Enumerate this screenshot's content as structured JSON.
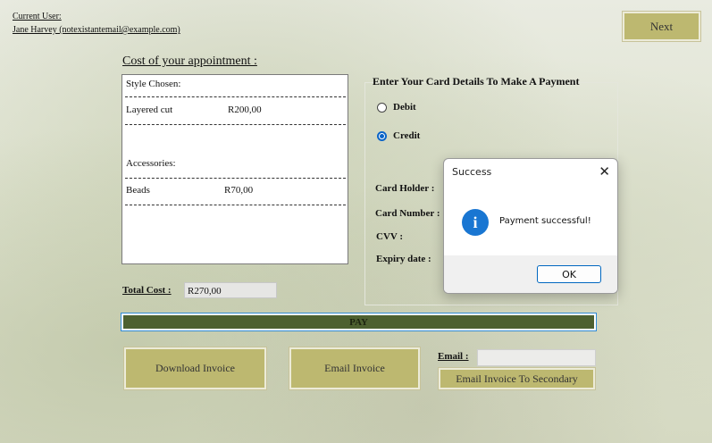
{
  "user": {
    "label": "Current User:",
    "name_email": "Jane Harvey (notexistantemail@example.com)"
  },
  "next_label": "Next",
  "cost": {
    "title": "Cost of your appointment :",
    "style_header": "Style Chosen:",
    "style_item": "Layered cut",
    "style_price": "R200,00",
    "accessories_header": "Accessories:",
    "accessory_item": "Beads",
    "accessory_price": "R70,00"
  },
  "card": {
    "title": "Enter Your Card Details To Make A Payment",
    "debit": "Debit",
    "credit": "Credit",
    "selected": "Credit",
    "holder": "Card Holder :",
    "number": "Card Number :",
    "cvv": "CVV :",
    "expiry": "Expiry date :"
  },
  "total": {
    "label": "Total Cost :",
    "value": "R270,00"
  },
  "pay_label": "PAY",
  "download_label": "Download Invoice",
  "email_invoice_label": "Email Invoice",
  "email": {
    "label": "Email :",
    "value": ""
  },
  "secondary_label": "Email Invoice To Secondary",
  "dialog": {
    "title": "Success",
    "message": "Payment successful!",
    "ok": "OK"
  },
  "colors": {
    "olive": "#bdb870",
    "pay_green": "#4d6030",
    "info_blue": "#1976d2"
  }
}
